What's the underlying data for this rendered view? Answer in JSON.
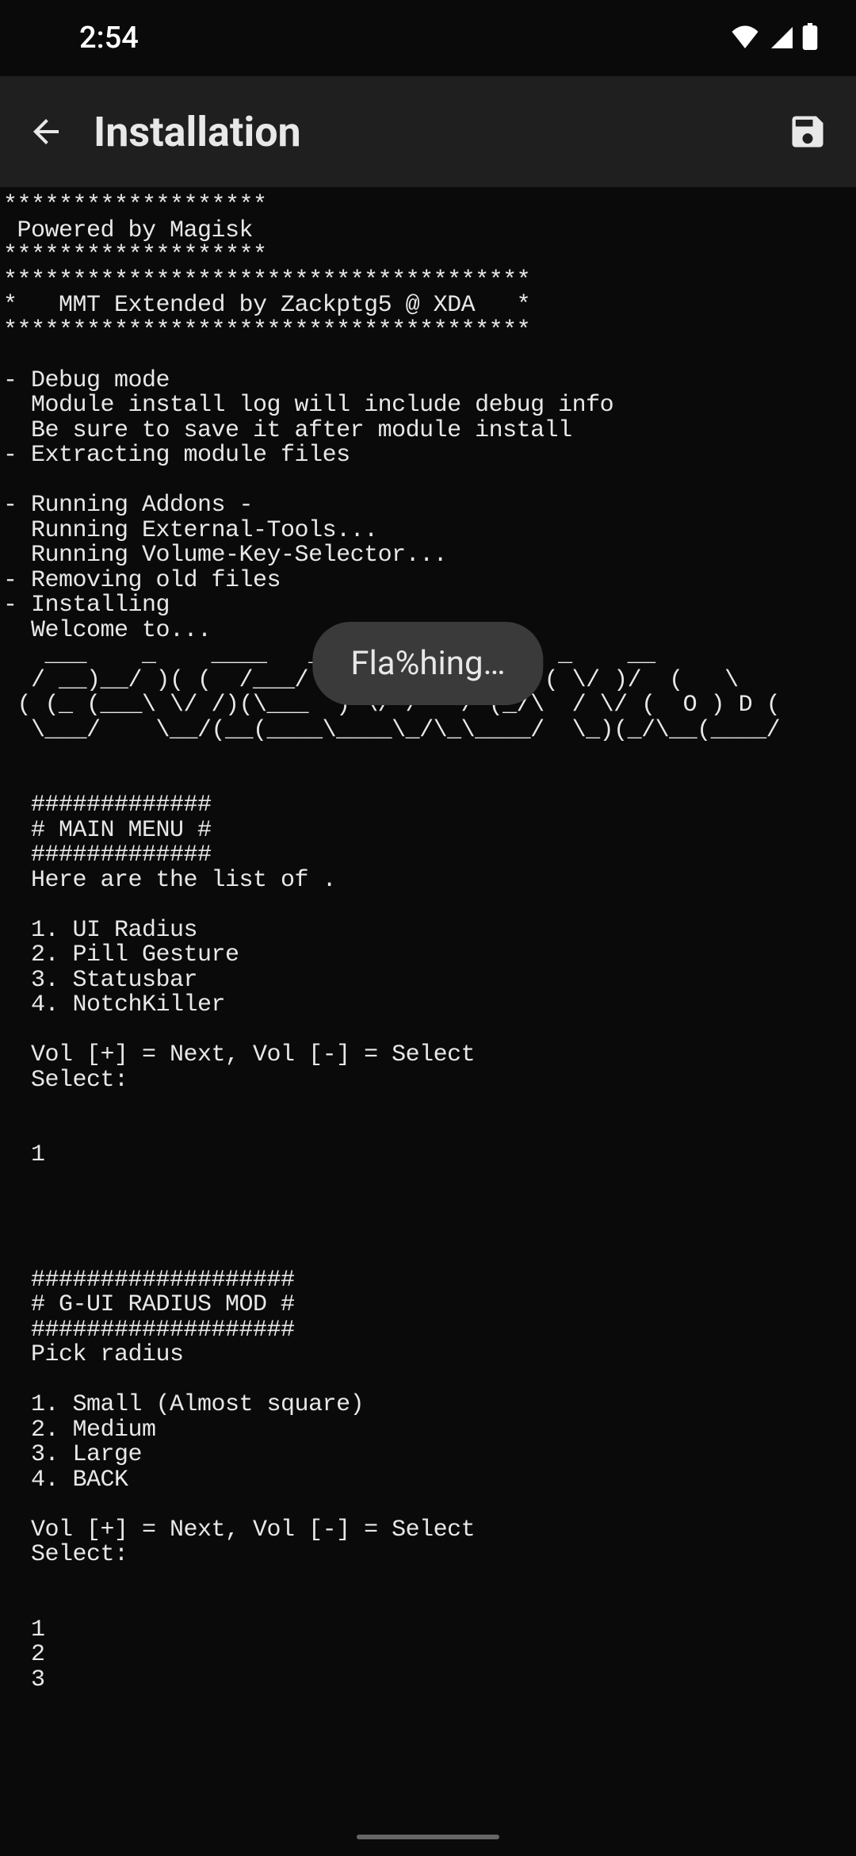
{
  "status": {
    "time": "2:54"
  },
  "header": {
    "title": "Installation"
  },
  "terminal": {
    "lines": [
      "*******************",
      " Powered by Magisk",
      "*******************",
      "**************************************",
      "*   MMT Extended by Zackptg5 @ XDA   *",
      "**************************************",
      "",
      "- Debug mode",
      "  Module install log will include debug info",
      "  Be sure to save it after module install",
      "- Extracting module files",
      "",
      "- Running Addons -",
      "  Running External-Tools...",
      "  Running Volume-Key-Selector...",
      "- Removing old files",
      "- Installing",
      "  Welcome to...",
      "   ___    _    ____   ___  __       __  _    __   ",
      "  / __)__/ )( (  /___/ )( \\/  _\\(  )   ( \\/ )/  (   \\",
      " ( (_ (___\\ \\/ /)(\\___  ) \\/ /   / (_/\\  / \\/ (  O ) D (",
      "  \\___/    \\__/(__(____\\____\\_/\\_\\____/  \\_)(_/\\__(____/",
      "",
      "",
      "  #############",
      "  # MAIN MENU #",
      "  #############",
      "  Here are the list of .",
      "",
      "  1. UI Radius",
      "  2. Pill Gesture",
      "  3. Statusbar",
      "  4. NotchKiller",
      "",
      "  Vol [+] = Next, Vol [-] = Select",
      "  Select:",
      "",
      "",
      "  1",
      "",
      "",
      "",
      "",
      "  ###################",
      "  # G-UI RADIUS MOD #",
      "  ###################",
      "  Pick radius",
      "",
      "  1. Small (Almost square)",
      "  2. Medium",
      "  3. Large",
      "  4. BACK",
      "",
      "  Vol [+] = Next, Vol [-] = Select",
      "  Select:",
      "",
      "",
      "  1",
      "  2",
      "  3"
    ]
  },
  "toast": {
    "message": "Fla%hing…"
  }
}
